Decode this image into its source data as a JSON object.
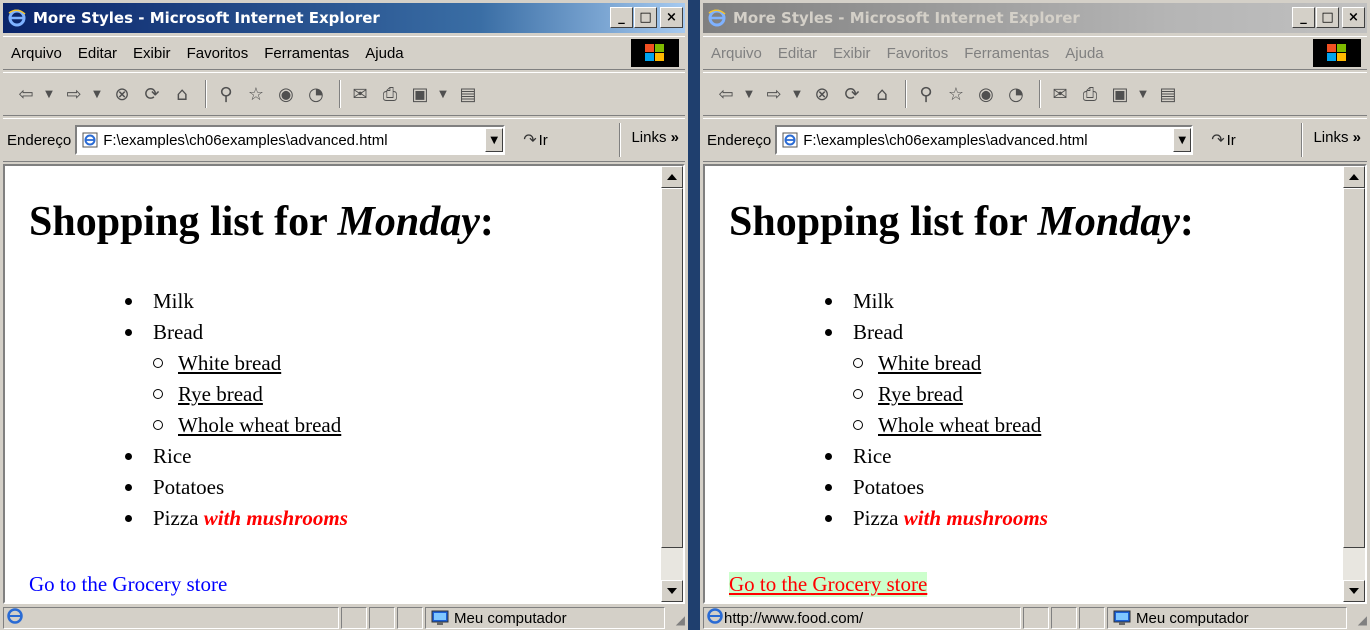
{
  "windows": [
    {
      "title": "More Styles - Microsoft Internet Explorer",
      "active": true,
      "menu": [
        "Arquivo",
        "Editar",
        "Exibir",
        "Favoritos",
        "Ferramentas",
        "Ajuda"
      ],
      "address_label": "Endereço",
      "address": "F:\\examples\\ch06examples\\advanced.html",
      "go_label": "Ir",
      "links_label": "Links",
      "links_chevron": "»",
      "page": {
        "heading_prefix": "Shopping list for ",
        "heading_day": "Monday",
        "heading_suffix": ":",
        "items": [
          "Milk",
          "Bread",
          "Rice",
          "Potatoes",
          "Pizza "
        ],
        "sub_items": [
          "White bread",
          "Rye bread",
          "Whole wheat bread"
        ],
        "pizza_extra": "with mushrooms",
        "link_text": "Go to the Grocery store"
      },
      "status_text": "",
      "status_zone": "Meu computador",
      "window_buttons": [
        "_",
        "□",
        "×"
      ]
    },
    {
      "title": "More Styles - Microsoft Internet Explorer",
      "active": false,
      "menu": [
        "Arquivo",
        "Editar",
        "Exibir",
        "Favoritos",
        "Ferramentas",
        "Ajuda"
      ],
      "address_label": "Endereço",
      "address": "F:\\examples\\ch06examples\\advanced.html",
      "go_label": "Ir",
      "links_label": "Links",
      "links_chevron": "»",
      "page": {
        "heading_prefix": "Shopping list for ",
        "heading_day": "Monday",
        "heading_suffix": ":",
        "items": [
          "Milk",
          "Bread",
          "Rice",
          "Potatoes",
          "Pizza "
        ],
        "sub_items": [
          "White bread",
          "Rye bread",
          "Whole wheat bread"
        ],
        "pizza_extra": "with mushrooms",
        "link_text": "Go to the Grocery store"
      },
      "status_text": "http://www.food.com/",
      "status_zone": "Meu computador",
      "window_buttons": [
        "_",
        "□",
        "×"
      ]
    }
  ],
  "colors": {
    "link_normal": "#0000ff",
    "link_hover": "#ff0000",
    "link_hover_background": "#ccffcc",
    "emphasis": "#ff0000"
  }
}
